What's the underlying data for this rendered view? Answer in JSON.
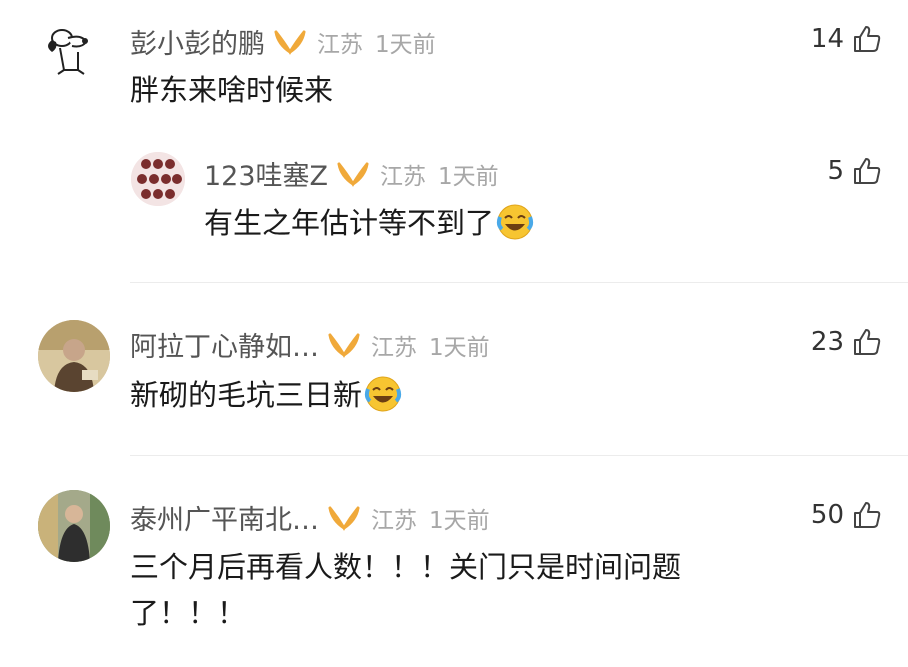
{
  "comments": [
    {
      "username": "彭小彭的鹏",
      "location": "江苏",
      "time": "1天前",
      "likes": "14",
      "text": "胖东来啥时候来",
      "avatar_icon": "snoopy-avatar"
    },
    {
      "username": "123哇塞Z",
      "location": "江苏",
      "time": "1天前",
      "likes": "5",
      "text": "有生之年估计等不到了",
      "emoji_icon": "crying-laughing-emoji",
      "avatar_icon": "group-photo-avatar",
      "is_reply": true
    },
    {
      "username": "阿拉丁心静如…",
      "location": "江苏",
      "time": "1天前",
      "likes": "23",
      "text": "新砌的毛坑三日新",
      "emoji_icon": "crying-laughing-emoji",
      "avatar_icon": "monk-avatar"
    },
    {
      "username": "泰州广平南北…",
      "location": "江苏",
      "time": "1天前",
      "likes": "50",
      "text_line1": "三个月后再看人数！！！关门只是时间问题",
      "text_line2": "了！！！",
      "avatar_icon": "person-in-store-avatar"
    }
  ],
  "colors": {
    "badge_gold": "#f0a93a",
    "username_gray": "#555555",
    "meta_gray": "#a7a7a7",
    "text_black": "#1a1a1a"
  }
}
